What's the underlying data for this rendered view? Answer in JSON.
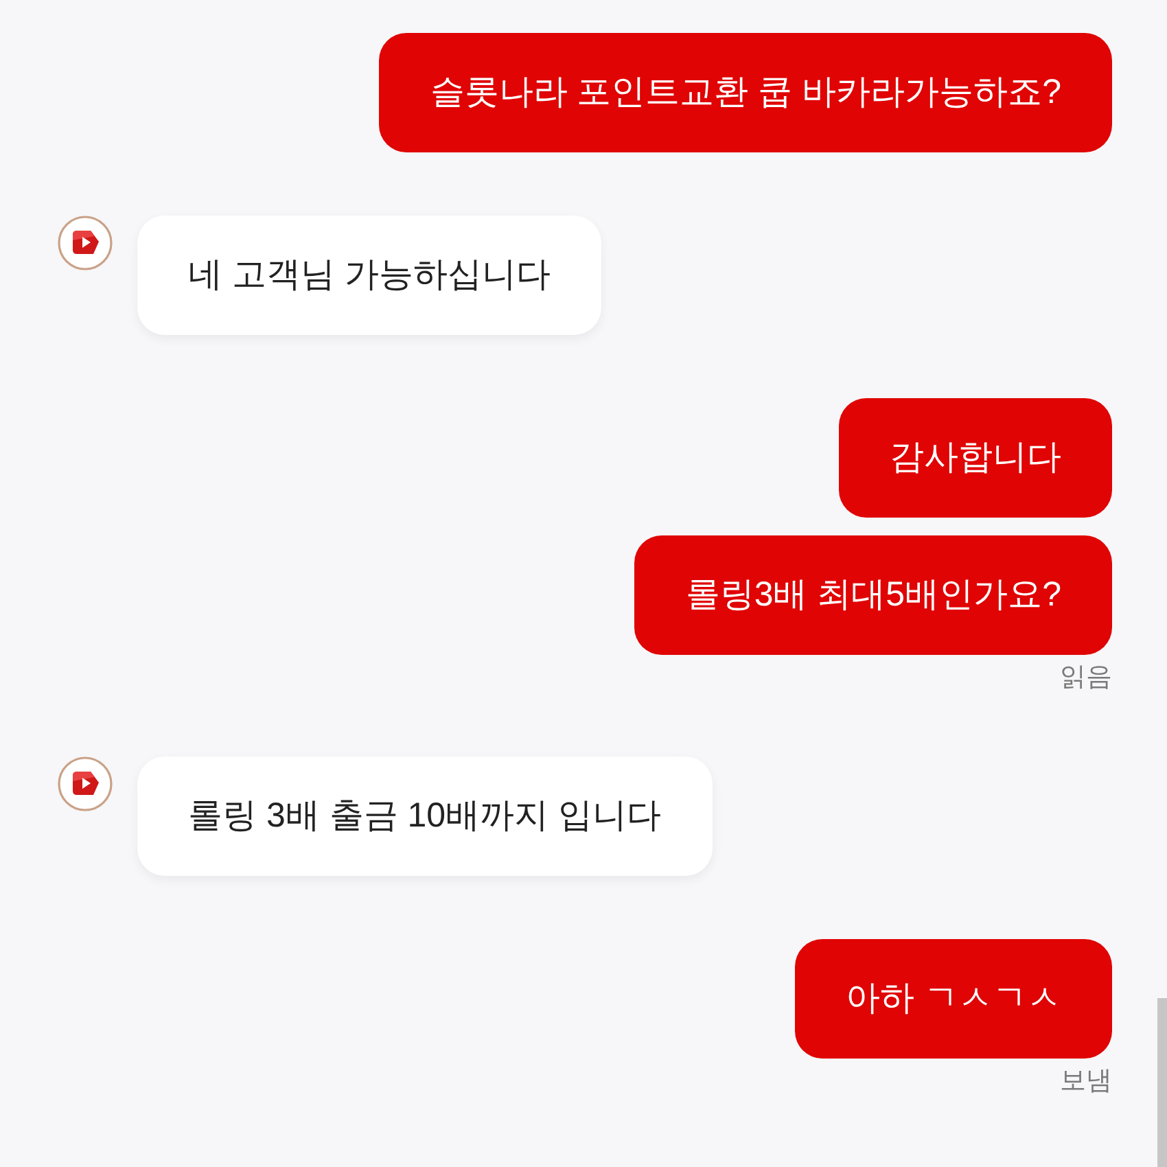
{
  "messages": [
    {
      "kind": "sent",
      "bubbles": [
        {
          "text": "슬롯나라 포인트교환 쿱 바카라가능하죠?"
        }
      ]
    },
    {
      "kind": "received",
      "bubbles": [
        {
          "text": "네 고객님 가능하십니다"
        }
      ]
    },
    {
      "kind": "sent",
      "bubbles": [
        {
          "text": "감사합니다"
        },
        {
          "text": "롤링3배 최대5배인가요?"
        }
      ],
      "status": "읽음"
    },
    {
      "kind": "received",
      "bubbles": [
        {
          "text": "롤링 3배 출금 10배까지 입니다"
        }
      ]
    },
    {
      "kind": "sent",
      "bubbles": [
        {
          "text": "아하 ㄱㅅㄱㅅ"
        }
      ],
      "status": "보냄"
    }
  ]
}
